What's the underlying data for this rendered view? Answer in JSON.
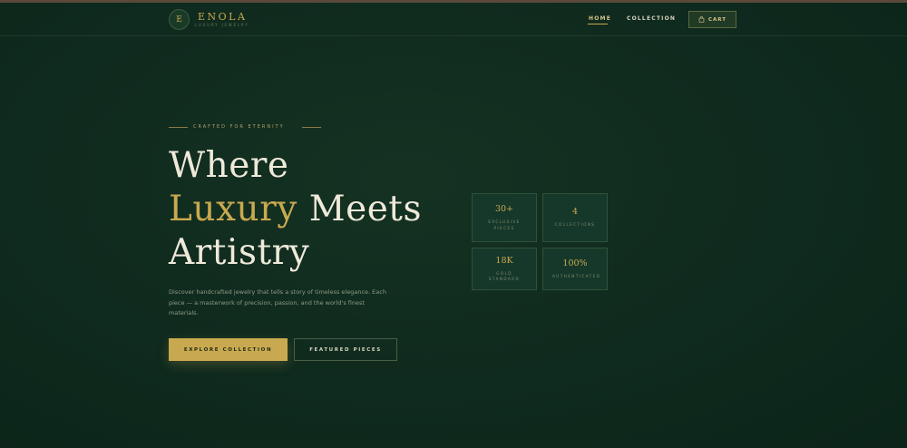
{
  "brand": {
    "mark": "E",
    "name": "ENOLA",
    "tagline": "LUXURY JEWELRY"
  },
  "nav": {
    "items": [
      {
        "label": "HOME",
        "active": true
      },
      {
        "label": "COLLECTION",
        "active": false
      }
    ],
    "cart_label": "CART"
  },
  "hero": {
    "eyebrow": "CRAFTED FOR ETERNITY",
    "headline": {
      "line1": "Where",
      "accent": "Luxury",
      "line2_rest": " Meets",
      "line3": "Artistry"
    },
    "description": "Discover handcrafted jewelry that tells a story of timeless elegance. Each piece — a masterwork of precision, passion, and the world's finest materials.",
    "primary_button": "EXPLORE COLLECTION",
    "secondary_button": "FEATURED PIECES"
  },
  "stats": [
    {
      "value": "30+",
      "label": "EXCLUSIVE PIECES"
    },
    {
      "value": "4",
      "label": "COLLECTIONS"
    },
    {
      "value": "18K",
      "label": "GOLD STANDARD"
    },
    {
      "value": "100%",
      "label": "AUTHENTICATED"
    }
  ],
  "colors": {
    "background": "#0f2a1e",
    "accent_gold": "#c9a94f",
    "text_light": "#efe9da"
  },
  "icons": {
    "cart": "shopping-bag-icon"
  }
}
